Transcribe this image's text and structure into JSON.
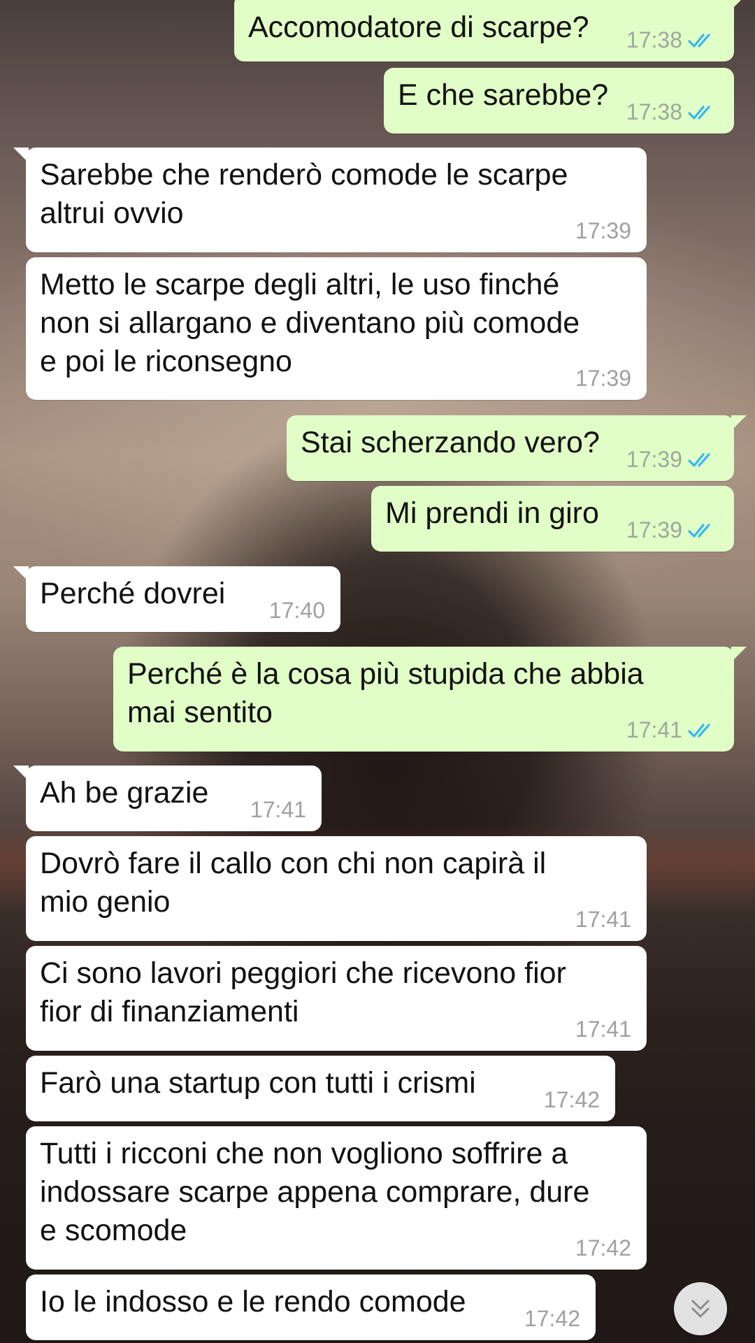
{
  "messages": [
    {
      "text": "Accomodatore di scarpe?",
      "time": "17:38",
      "dir": "out"
    },
    {
      "text": "E che sarebbe?",
      "time": "17:38",
      "dir": "out"
    },
    {
      "text": "Sarebbe che renderò comode le scarpe\naltrui ovvio",
      "time": "17:39",
      "dir": "in"
    },
    {
      "text": "Metto le scarpe degli altri, le uso finché\nnon si allargano e diventano più comode\ne poi le riconsegno",
      "time": "17:39",
      "dir": "in"
    },
    {
      "text": "Stai scherzando vero?",
      "time": "17:39",
      "dir": "out"
    },
    {
      "text": "Mi prendi in giro",
      "time": "17:39",
      "dir": "out"
    },
    {
      "text": "Perché dovrei",
      "time": "17:40",
      "dir": "in"
    },
    {
      "text": "Perché è la cosa più stupida che abbia\nmai sentito",
      "time": "17:41",
      "dir": "out"
    },
    {
      "text": "Ah be grazie",
      "time": "17:41",
      "dir": "in"
    },
    {
      "text": "Dovrò fare il callo con chi non capirà il\nmio genio",
      "time": "17:41",
      "dir": "in"
    },
    {
      "text": "Ci sono lavori peggiori che ricevono fior\nfior di finanziamenti",
      "time": "17:41",
      "dir": "in"
    },
    {
      "text": "Farò una startup con tutti i crismi",
      "time": "17:42",
      "dir": "in"
    },
    {
      "text": "Tutti i ricconi che non vogliono soffrire a\nindossare scarpe appena comprare, dure\ne scomode",
      "time": "17:42",
      "dir": "in"
    },
    {
      "text": "Io le indosso e le rendo comode",
      "time": "17:42",
      "dir": "in"
    }
  ],
  "colors": {
    "incoming_bubble": "#ffffff",
    "outgoing_bubble": "#e1fec6",
    "read_ticks": "#34b7f1",
    "timestamp": "#a0a0a0"
  },
  "icons": {
    "read_receipt": "double-check-icon",
    "scroll_down": "chevron-down-double-icon"
  }
}
